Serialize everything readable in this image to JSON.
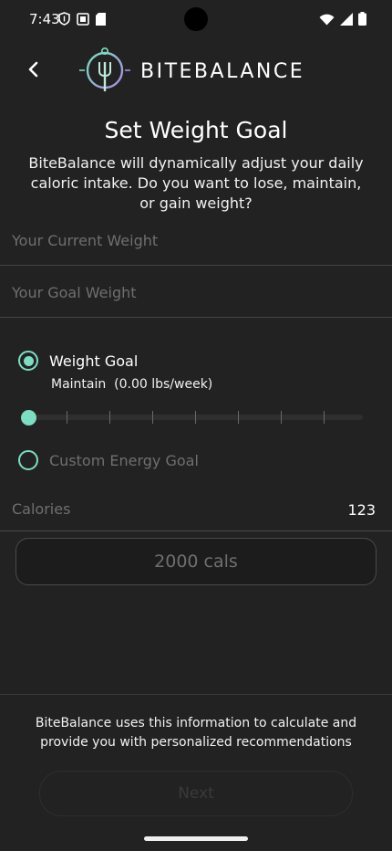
{
  "status_bar": {
    "time": "7:43",
    "left_icons": [
      "shield-icon",
      "copy-icon",
      "sd-card-icon"
    ],
    "right_icons": [
      "wifi-icon",
      "signal-icon",
      "battery-icon"
    ]
  },
  "header": {
    "back_icon": "back-chevron-icon",
    "logo_icon": "fork-logo-icon",
    "brand_name": "BITEBALANCE"
  },
  "title": "Set Weight Goal",
  "subtitle": "BiteBalance will dynamically adjust your daily caloric intake. Do you want to lose, maintain, or gain weight?",
  "fields": {
    "current_weight_placeholder": "Your Current Weight",
    "goal_weight_placeholder": "Your Goal Weight"
  },
  "weight_goal": {
    "label": "Weight Goal",
    "selected": true,
    "description": "Maintain  (0.00 lbs/week)",
    "slider_value_fraction": 0.0,
    "slider_steps": 8
  },
  "custom_energy": {
    "label": "Custom Energy Goal",
    "selected": false
  },
  "calories": {
    "label": "Calories",
    "value": "123",
    "energy_box": "2000 cals"
  },
  "footer": {
    "note": "BiteBalance uses this information to calculate and provide you with personalized recommendations",
    "next_label": "Next"
  },
  "colors": {
    "background": "#222222",
    "accent": "#7ddcc1",
    "placeholder": "#6f6f6f"
  }
}
